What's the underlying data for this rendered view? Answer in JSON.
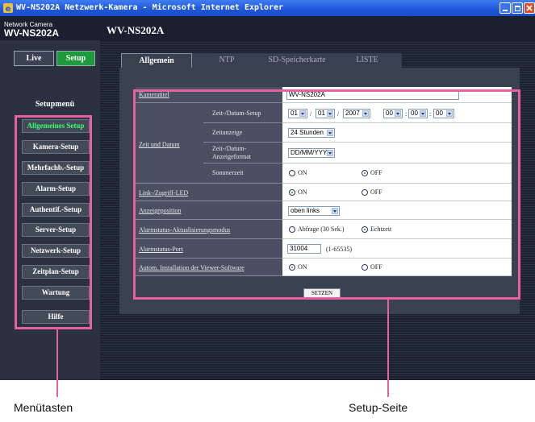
{
  "window": {
    "title": "WV-NS202A Netzwerk-Kamera - Microsoft Internet Explorer"
  },
  "header": {
    "brand_small": "Network Camera",
    "brand_big": "WV-NS202A",
    "model": "WV-NS202A"
  },
  "mode_buttons": {
    "live": "Live",
    "setup": "Setup"
  },
  "sidebar": {
    "title": "Setupmenü",
    "items": [
      {
        "label": "Allgemeines Setup",
        "active": true
      },
      {
        "label": "Kamera-Setup"
      },
      {
        "label": "Mehrfachb.-Setup"
      },
      {
        "label": "Alarm-Setup"
      },
      {
        "label": "Authentif.-Setup"
      },
      {
        "label": "Server-Setup"
      },
      {
        "label": "Netzwerk-Setup"
      },
      {
        "label": "Zeitplan-Setup"
      },
      {
        "label": "Wartung"
      },
      {
        "label": "Hilfe"
      }
    ]
  },
  "tabs": [
    {
      "label": "Allgemein",
      "active": true
    },
    {
      "label": "NTP"
    },
    {
      "label": "SD-Speicherkarte"
    },
    {
      "label": "LISTE"
    }
  ],
  "form": {
    "kameratitel": {
      "label": "Kameratitel",
      "value": "WV-NS202A"
    },
    "zeit_und_datum": {
      "label": "Zeit und Datum",
      "setup": {
        "label": "Zeit-/Datum-Setup",
        "month": "01",
        "day": "01",
        "year": "2007",
        "hour": "00",
        "minute": "00",
        "second": "00",
        "sep_slash": "/",
        "sep_colon": ":"
      },
      "anzeige": {
        "label": "Zeitanzeige",
        "value": "24 Stunden"
      },
      "format": {
        "label_line1": "Zeit-/Datum-",
        "label_line2": "Anzeigeformat",
        "value": "DD/MM/YYYY"
      },
      "sommerzeit": {
        "label": "Sommerzeit",
        "on": "ON",
        "off": "OFF",
        "selected": "OFF"
      }
    },
    "led": {
      "label": "Link-/Zugriff-LED",
      "on": "ON",
      "off": "OFF",
      "selected": "ON"
    },
    "anzeigeposition": {
      "label": "Anzeigeposition",
      "value": "oben links"
    },
    "alarmstatus_modus": {
      "label": "Alarmstatus-Aktualisierungsmodus",
      "opt1": "Abfrage (30 Sek.)",
      "opt2": "Echtzeit",
      "selected": "Echtzeit"
    },
    "alarmstatus_port": {
      "label": "Alarmstatus-Port",
      "value": "31004",
      "range": "(1-65535)"
    },
    "viewer": {
      "label": "Autom. Installation der Viewer-Software",
      "on": "ON",
      "off": "OFF",
      "selected": "ON"
    },
    "submit": "SETZEN"
  },
  "callouts": {
    "menu": "Menütasten",
    "setup": "Setup-Seite"
  },
  "colors": {
    "accent_green": "#1c9a3c",
    "highlight_pink": "#e7609f",
    "titlebar_blue": "#1e56d8"
  }
}
